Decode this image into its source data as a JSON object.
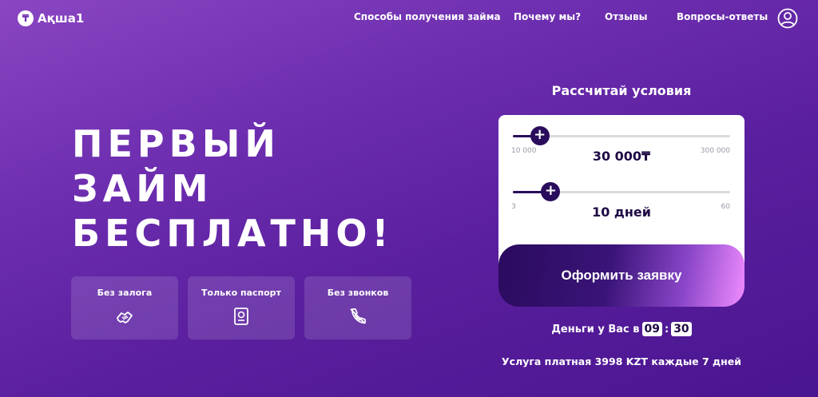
{
  "header": {
    "logo_mark": "₸",
    "logo_text": "Ақша1",
    "nav": [
      {
        "label": "Способы получения займа"
      },
      {
        "label": "Почему мы?"
      },
      {
        "label": "Отзывы"
      },
      {
        "label": "Вопросы-ответы"
      }
    ],
    "icons": {
      "profile": "user-circle-icon"
    }
  },
  "hero": {
    "title_line1": "ПЕРВЫЙ",
    "title_line2": "ЗАЙМ",
    "title_line3": "БЕСПЛАТНО!"
  },
  "features": [
    {
      "label": "Без залога",
      "icon": "handshake-icon"
    },
    {
      "label": "Только паспорт",
      "icon": "passport-icon"
    },
    {
      "label": "Без звонков",
      "icon": "no-calls-icon"
    }
  ],
  "calculator": {
    "title": "Рассчитай условия",
    "amount": {
      "min_label": "10 000",
      "max_label": "300 000",
      "value_text": "30 000₸",
      "min": 10000,
      "max": 300000,
      "value": 30000
    },
    "term": {
      "min_label": "3",
      "max_label": "60",
      "value_text": "10 дней",
      "min": 3,
      "max": 60,
      "value": 10
    },
    "submit_label": "Оформить заявку"
  },
  "timer": {
    "prefix": "Деньги у Вас в",
    "hours": "09",
    "separator": ":",
    "minutes": "30"
  },
  "notice": "Услуга платная 3998 KZT каждые 7 дней",
  "colors": {
    "accent_dark": "#2a0c5c",
    "background": "#6e2fb0",
    "button_end": "#f08cff"
  }
}
